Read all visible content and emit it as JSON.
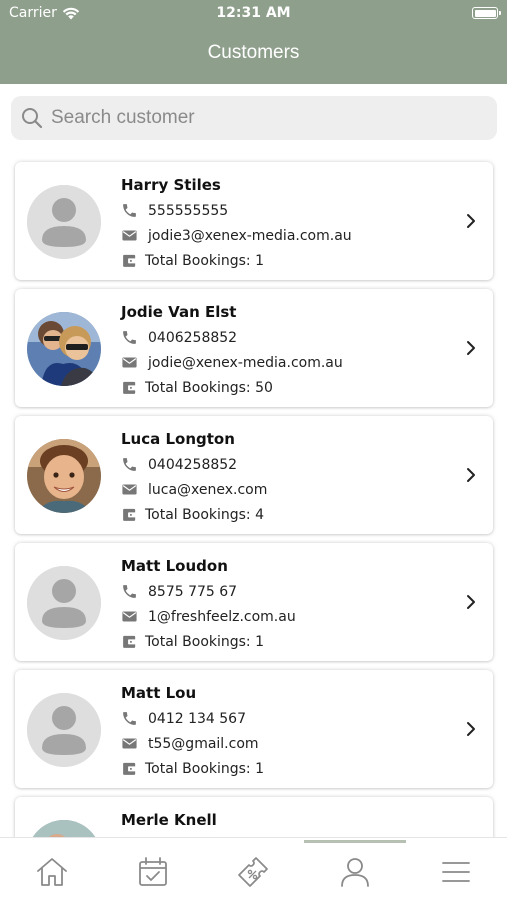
{
  "status": {
    "carrier": "Carrier",
    "time": "12:31 AM"
  },
  "header": {
    "title": "Customers",
    "color": "#8e9f8c"
  },
  "search": {
    "placeholder": "Search customer",
    "value": ""
  },
  "customers": [
    {
      "name": "Harry Stiles",
      "phone": "555555555",
      "email": "jodie3@xenex-media.com.au",
      "bookings": "Total Bookings: 1",
      "avatar": "placeholder"
    },
    {
      "name": "Jodie Van Elst",
      "phone": "0406258852",
      "email": "jodie@xenex-media.com.au",
      "bookings": "Total Bookings: 50",
      "avatar": "photo"
    },
    {
      "name": "Luca Longton",
      "phone": "0404258852",
      "email": "luca@xenex.com",
      "bookings": "Total Bookings: 4",
      "avatar": "photo"
    },
    {
      "name": "Matt Loudon",
      "phone": "8575 775 67",
      "email": "1@freshfeelz.com.au",
      "bookings": "Total Bookings: 1",
      "avatar": "placeholder"
    },
    {
      "name": "Matt Lou",
      "phone": "0412 134 567",
      "email": "t55@gmail.com",
      "bookings": "Total Bookings: 1",
      "avatar": "placeholder"
    },
    {
      "name": "Merle Knell",
      "avatar": "photo"
    }
  ],
  "tabs": [
    {
      "icon": "home-icon"
    },
    {
      "icon": "calendar-check-icon"
    },
    {
      "icon": "ticket-discount-icon"
    },
    {
      "icon": "person-icon",
      "active": true
    },
    {
      "icon": "menu-icon"
    }
  ]
}
